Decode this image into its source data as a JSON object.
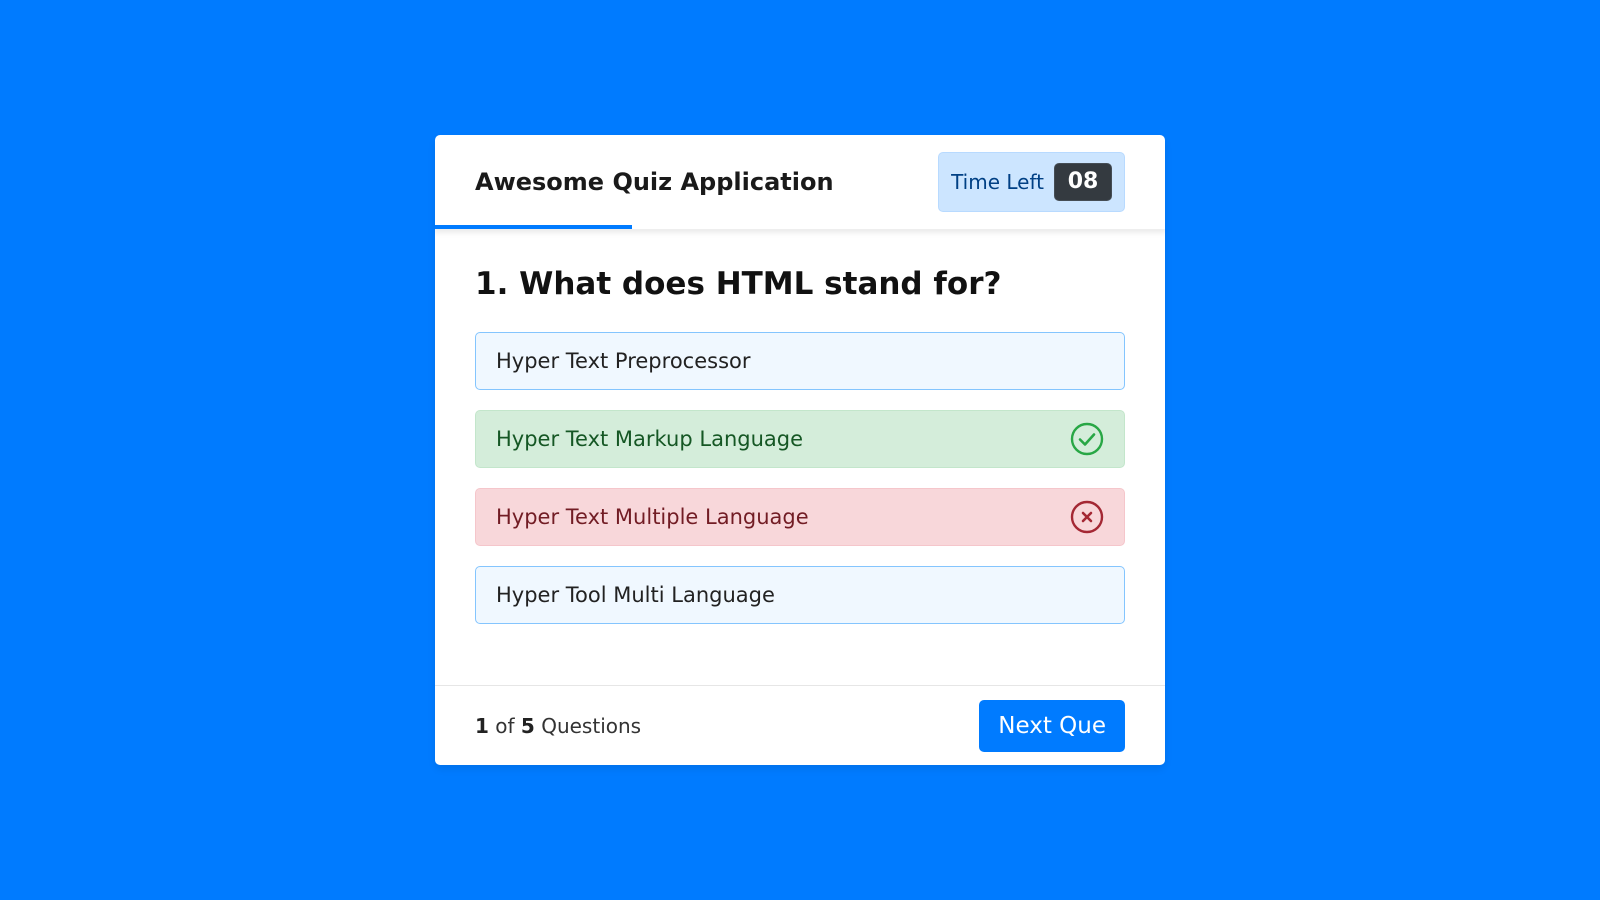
{
  "colors": {
    "background": "#007bff",
    "accent": "#007bff",
    "correct": "#155724",
    "incorrect": "#721c24"
  },
  "header": {
    "title": "Awesome Quiz Application",
    "timer_label": "Time Left",
    "timer_seconds": "08",
    "time_progress_fraction": 0.27
  },
  "question": {
    "text": "1. What does HTML stand for?",
    "options": [
      {
        "label": "Hyper Text Preprocessor",
        "state": "neutral"
      },
      {
        "label": "Hyper Text Markup Language",
        "state": "correct",
        "icon": "check-circle-icon"
      },
      {
        "label": "Hyper Text Multiple Language",
        "state": "incorrect",
        "icon": "x-circle-icon"
      },
      {
        "label": "Hyper Tool Multi Language",
        "state": "neutral"
      }
    ]
  },
  "footer": {
    "current": "1",
    "of_text": "of",
    "total": "5",
    "questions_text": "Questions",
    "next_label": "Next Que"
  }
}
